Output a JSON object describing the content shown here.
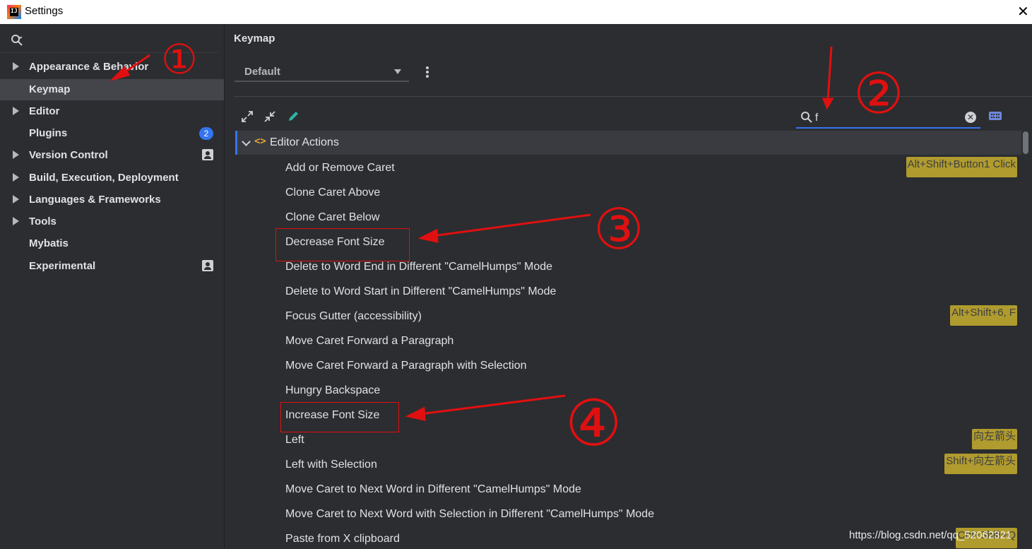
{
  "window": {
    "title": "Settings"
  },
  "sidebar": {
    "search_placeholder": "",
    "items": [
      {
        "label": "Appearance & Behavior",
        "expandable": true
      },
      {
        "label": "Keymap",
        "selected": true
      },
      {
        "label": "Editor",
        "expandable": true
      },
      {
        "label": "Plugins",
        "badge": "2"
      },
      {
        "label": "Version Control",
        "expandable": true,
        "icon": "profile-icon"
      },
      {
        "label": "Build, Execution, Deployment",
        "expandable": true
      },
      {
        "label": "Languages & Frameworks",
        "expandable": true
      },
      {
        "label": "Tools",
        "expandable": true
      },
      {
        "label": "Mybatis"
      },
      {
        "label": "Experimental",
        "icon": "profile-icon"
      }
    ]
  },
  "main": {
    "title": "Keymap",
    "keymap_selected": "Default",
    "search_value": "f",
    "toolbar_icons": [
      "expand-all-icon",
      "collapse-all-icon",
      "edit-icon"
    ],
    "group": {
      "label": "Editor Actions",
      "icon": "code-icon"
    },
    "actions": [
      {
        "label": "Add or Remove Caret",
        "shortcut": "Alt+Shift+Button1 Click"
      },
      {
        "label": "Clone Caret Above"
      },
      {
        "label": "Clone Caret Below"
      },
      {
        "label": "Decrease Font Size"
      },
      {
        "label": "Delete to Word End in Different \"CamelHumps\" Mode"
      },
      {
        "label": "Delete to Word Start in Different \"CamelHumps\" Mode"
      },
      {
        "label": "Focus Gutter (accessibility)",
        "shortcut": "Alt+Shift+6, F"
      },
      {
        "label": "Move Caret Forward a Paragraph"
      },
      {
        "label": "Move Caret Forward a Paragraph with Selection"
      },
      {
        "label": "Hungry Backspace"
      },
      {
        "label": "Increase Font Size"
      },
      {
        "label": "Left",
        "shortcut": "向左箭头"
      },
      {
        "label": "Left with Selection",
        "shortcut": "Shift+向左箭头"
      },
      {
        "label": "Move Caret to Next Word in Different \"CamelHumps\" Mode"
      },
      {
        "label": "Move Caret to Next Word with Selection in Different \"CamelHumps\" Mode"
      },
      {
        "label": "Paste from X clipboard",
        "shortcut": "Ctrl+Shift+Q"
      }
    ]
  },
  "annotations": [
    "①",
    "②",
    "③",
    "④"
  ],
  "watermark": "https://blog.csdn.net/qq_52062321",
  "colors": {
    "accent": "#3574f0",
    "shortcut_bg": "#b09b2e",
    "annotation": "#e01010",
    "background": "#2b2d30"
  }
}
